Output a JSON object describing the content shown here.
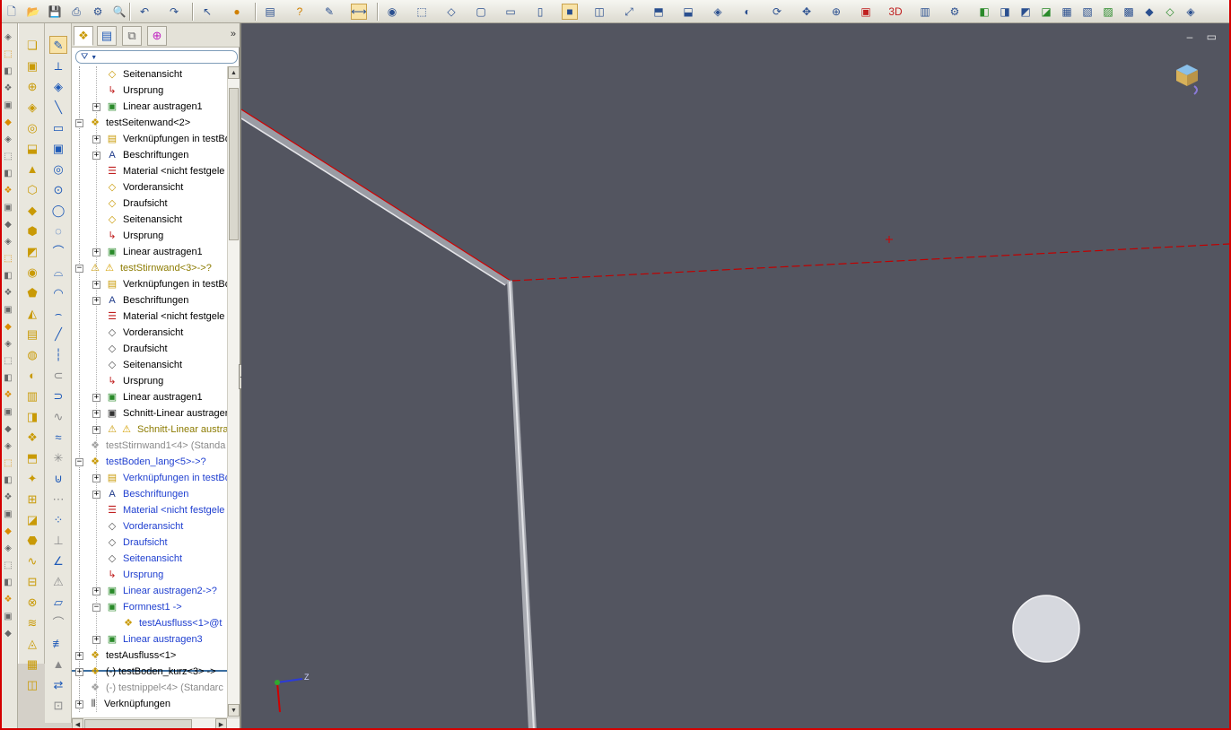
{
  "toolbar": {
    "icons": [
      "new-icon",
      "open-icon",
      "save-icon",
      "print-icon",
      "options-icon",
      "print-preview-icon",
      "undo-icon",
      "redo-icon",
      "select-icon",
      "rebuild-icon",
      "properties-icon",
      "help-icon",
      "sketch-icon",
      "smart-dimension-icon",
      "appearance-icon",
      "view-orientation-icon",
      "isometric-icon",
      "front-view-icon",
      "top-view-icon",
      "right-view-icon",
      "shaded-icon",
      "section-view-icon",
      "zoom-fit-icon",
      "hidden-lines-icon",
      "wireframe-icon",
      "perspective-icon",
      "shadows-icon",
      "rotate-icon",
      "pan-icon",
      "zoom-icon",
      "render-icon",
      "3d-icon",
      "material-icon",
      "options-icon-2"
    ]
  },
  "featuremanager": {
    "filter_symbol": "▼",
    "rows": [
      {
        "indent": 2,
        "expander": "",
        "icon": "plane-icon",
        "label": "Seitenansicht",
        "style": "normal"
      },
      {
        "indent": 2,
        "expander": "",
        "icon": "origin-icon",
        "label": "Ursprung",
        "style": "normal"
      },
      {
        "indent": 2,
        "expander": "+",
        "icon": "extrude-icon",
        "label": "Linear austragen1",
        "style": "normal"
      },
      {
        "indent": 1,
        "expander": "−",
        "icon": "part-icon",
        "label": "testSeitenwand<2>",
        "style": "normal"
      },
      {
        "indent": 2,
        "expander": "+",
        "icon": "mates-folder-icon",
        "label": "Verknüpfungen in testBo",
        "style": "normal"
      },
      {
        "indent": 2,
        "expander": "+",
        "icon": "annotations-icon",
        "label": "Beschriftungen",
        "style": "normal"
      },
      {
        "indent": 2,
        "expander": "",
        "icon": "material-icon",
        "label": "Material <nicht festgele",
        "style": "normal"
      },
      {
        "indent": 2,
        "expander": "",
        "icon": "plane-icon",
        "label": "Vorderansicht",
        "style": "normal"
      },
      {
        "indent": 2,
        "expander": "",
        "icon": "plane-icon",
        "label": "Draufsicht",
        "style": "normal"
      },
      {
        "indent": 2,
        "expander": "",
        "icon": "plane-icon",
        "label": "Seitenansicht",
        "style": "normal"
      },
      {
        "indent": 2,
        "expander": "",
        "icon": "origin-icon",
        "label": "Ursprung",
        "style": "normal"
      },
      {
        "indent": 2,
        "expander": "+",
        "icon": "extrude-icon",
        "label": "Linear austragen1",
        "style": "normal"
      },
      {
        "indent": 1,
        "expander": "−",
        "icon": "part-warning-icon",
        "label": "testStirnwand<3>->?",
        "style": "olive"
      },
      {
        "indent": 2,
        "expander": "+",
        "icon": "mates-folder-icon",
        "label": "Verknüpfungen in testBo",
        "style": "normal"
      },
      {
        "indent": 2,
        "expander": "+",
        "icon": "annotations-icon",
        "label": "Beschriftungen",
        "style": "normal"
      },
      {
        "indent": 2,
        "expander": "",
        "icon": "material-icon",
        "label": "Material <nicht festgele",
        "style": "normal"
      },
      {
        "indent": 2,
        "expander": "",
        "icon": "plane-outline-icon",
        "label": "Vorderansicht",
        "style": "normal"
      },
      {
        "indent": 2,
        "expander": "",
        "icon": "plane-outline-icon",
        "label": "Draufsicht",
        "style": "normal"
      },
      {
        "indent": 2,
        "expander": "",
        "icon": "plane-outline-icon",
        "label": "Seitenansicht",
        "style": "normal"
      },
      {
        "indent": 2,
        "expander": "",
        "icon": "origin-icon",
        "label": "Ursprung",
        "style": "normal"
      },
      {
        "indent": 2,
        "expander": "+",
        "icon": "extrude-icon",
        "label": "Linear austragen1",
        "style": "normal"
      },
      {
        "indent": 2,
        "expander": "+",
        "icon": "cut-extrude-icon",
        "label": "Schnitt-Linear austrager",
        "style": "normal"
      },
      {
        "indent": 2,
        "expander": "+",
        "icon": "cut-extrude-warning-icon",
        "label": "Schnitt-Linear austra",
        "style": "warn"
      },
      {
        "indent": 1,
        "expander": "",
        "icon": "part-suppressed-icon",
        "label": "testStirnwand1<4> (Standa",
        "style": "gray"
      },
      {
        "indent": 1,
        "expander": "−",
        "icon": "part-icon",
        "label": "testBoden_lang<5>->?",
        "style": "blue"
      },
      {
        "indent": 2,
        "expander": "+",
        "icon": "mates-folder-icon",
        "label": "Verknüpfungen in testBo",
        "style": "blue"
      },
      {
        "indent": 2,
        "expander": "+",
        "icon": "annotations-icon",
        "label": "Beschriftungen",
        "style": "blue"
      },
      {
        "indent": 2,
        "expander": "",
        "icon": "material-icon",
        "label": "Material <nicht festgele",
        "style": "blue"
      },
      {
        "indent": 2,
        "expander": "",
        "icon": "plane-outline-icon",
        "label": "Vorderansicht",
        "style": "blue"
      },
      {
        "indent": 2,
        "expander": "",
        "icon": "plane-outline-icon",
        "label": "Draufsicht",
        "style": "blue"
      },
      {
        "indent": 2,
        "expander": "",
        "icon": "plane-outline-icon",
        "label": "Seitenansicht",
        "style": "blue"
      },
      {
        "indent": 2,
        "expander": "",
        "icon": "origin-icon",
        "label": "Ursprung",
        "style": "blue"
      },
      {
        "indent": 2,
        "expander": "+",
        "icon": "extrude-icon",
        "label": "Linear austragen2->?",
        "style": "blue"
      },
      {
        "indent": 2,
        "expander": "−",
        "icon": "cavity-icon",
        "label": "Formnest1 ->",
        "style": "blue"
      },
      {
        "indent": 3,
        "expander": "",
        "icon": "part-icon",
        "label": "testAusfluss<1>@t",
        "style": "blue"
      },
      {
        "indent": 2,
        "expander": "+",
        "icon": "extrude-icon",
        "label": "Linear austragen3",
        "style": "blue"
      },
      {
        "indent": 1,
        "expander": "+",
        "icon": "part-icon",
        "label": "testAusfluss<1>",
        "style": "normal"
      },
      {
        "indent": 1,
        "expander": "+",
        "icon": "part-icon",
        "label": "(-) testBoden_kurz<3> ->",
        "style": "normal"
      },
      {
        "indent": 1,
        "expander": "",
        "icon": "part-suppressed-icon",
        "label": "(-) testnippel<4> (Standarc",
        "style": "gray"
      },
      {
        "indent": 0,
        "expander": "+",
        "icon": "mates-icon",
        "label": "Verknüpfungen",
        "style": "normal"
      }
    ]
  },
  "viewport": {
    "background": "#535560",
    "edge_color": "#d00000",
    "window_controls": "– ▭",
    "triad_axis_label": "Z"
  },
  "colors": {
    "frame": "#d40000",
    "blue_text": "#1f3fd0",
    "gray_text": "#8a8a8a",
    "olive_text": "#8c7b00"
  }
}
